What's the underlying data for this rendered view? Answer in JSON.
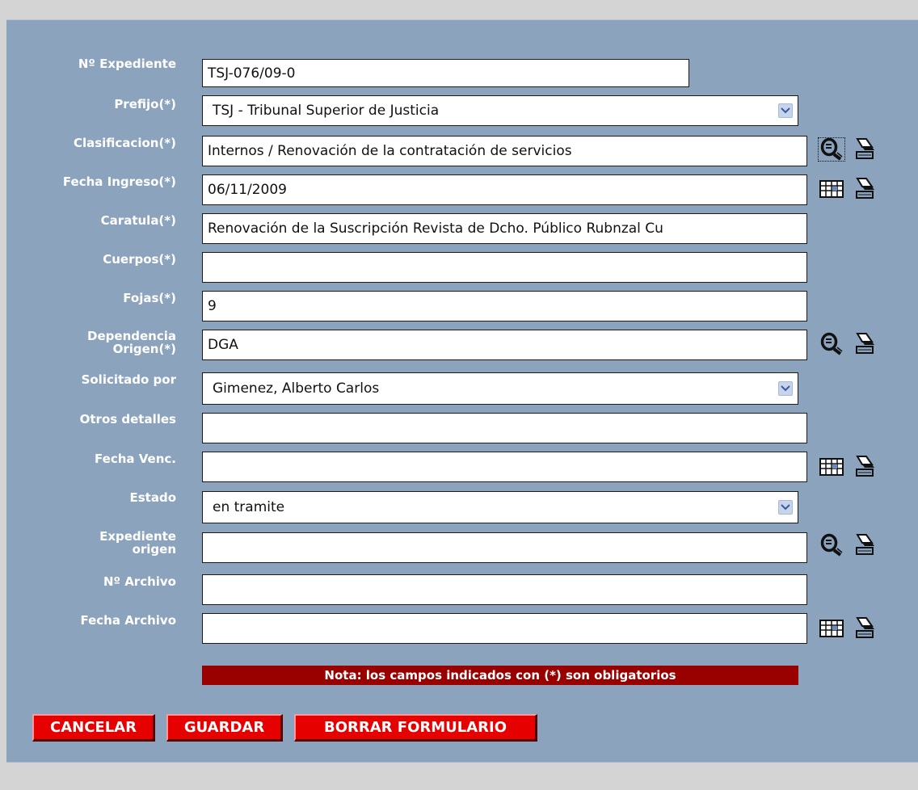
{
  "form": {
    "expediente": {
      "label": "Nº Expediente",
      "value": "TSJ-076/09-0"
    },
    "prefijo": {
      "label": "Prefijo(*)",
      "value": "TSJ - Tribunal Superior de Justicia"
    },
    "clasificacion": {
      "label": "Clasificacion(*)",
      "value": "Internos / Renovación de la contratación de servicios"
    },
    "fecha_ingreso": {
      "label": "Fecha Ingreso(*)",
      "value": "06/11/2009"
    },
    "caratula": {
      "label": "Caratula(*)",
      "value": "Renovación de la Suscripción Revista de Dcho. Público Rubnzal Cu"
    },
    "cuerpos": {
      "label": "Cuerpos(*)",
      "value": ""
    },
    "fojas": {
      "label": "Fojas(*)",
      "value": "9"
    },
    "dependencia_origen": {
      "label_line1": "Dependencia",
      "label_line2": "Origen(*)",
      "value": "DGA"
    },
    "solicitado_por": {
      "label": "Solicitado por",
      "value": "Gimenez, Alberto Carlos"
    },
    "otros_detalles": {
      "label": "Otros detalles",
      "value": ""
    },
    "fecha_venc": {
      "label": "Fecha Venc.",
      "value": ""
    },
    "estado": {
      "label": "Estado",
      "value": "en tramite"
    },
    "expediente_origen": {
      "label_line1": "Expediente",
      "label_line2": "origen",
      "value": ""
    },
    "num_archivo": {
      "label": "Nº Archivo",
      "value": ""
    },
    "fecha_archivo": {
      "label": "Fecha Archivo",
      "value": ""
    }
  },
  "icons": {
    "search": "search-icon",
    "calendar": "calendar-icon",
    "eraser": "eraser-icon"
  },
  "nota": "Nota: los campos indicados con (*) son obligatorios",
  "buttons": {
    "cancelar": "CANCELAR",
    "guardar": "GUARDAR",
    "borrar": "BORRAR FORMULARIO"
  },
  "colors": {
    "panel_bg": "#8ba3bc",
    "page_bg": "#d4d4d4",
    "nota_bg": "#990000",
    "button_bg": "#e60000"
  }
}
